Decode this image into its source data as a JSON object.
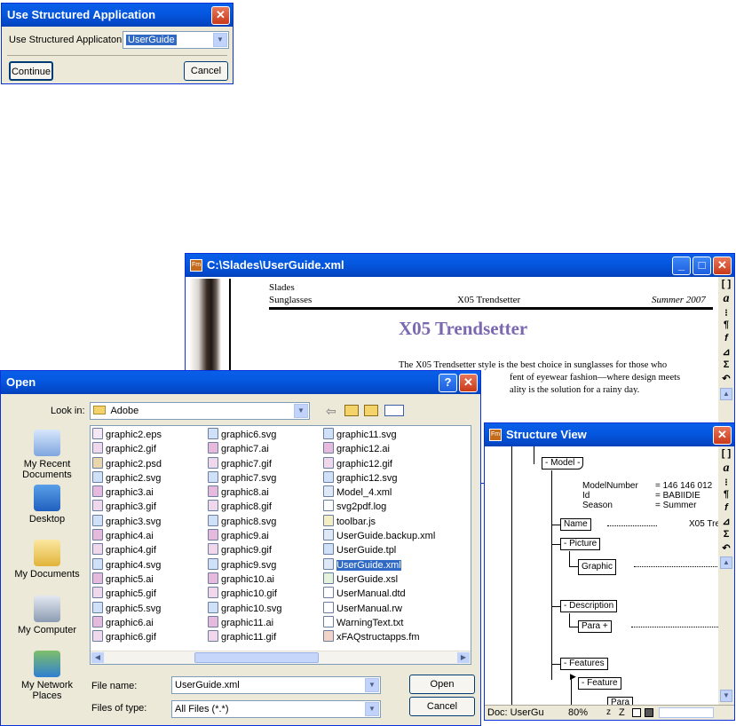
{
  "structured_dialog": {
    "title": "Use Structured Application",
    "label": "Use Structured Applicaton:",
    "value": "UserGuide",
    "continue_label": "Continue",
    "cancel_label": "Cancel"
  },
  "doc_window": {
    "title": "C:\\Slades\\UserGuide.xml",
    "header_brand": "Slades",
    "header_category": "Sunglasses",
    "header_center": "X05  Trendsetter",
    "header_season": "Summer  2007",
    "heading": "X05 Trendsetter",
    "body_lines": [
      "The X05 Trendsetter style is the best choice in sunglasses for those who",
      "fent of eyewear fashion—where design meets",
      "ality is the solution for a rainy day."
    ],
    "heading_color": "#7a68b0",
    "tools": [
      "[ ]",
      "a",
      "⁝",
      "¶",
      "f",
      "⊿",
      "Σ",
      "↶"
    ]
  },
  "open_dialog": {
    "title": "Open",
    "look_in_label": "Look in:",
    "look_in_value": "Adobe",
    "places": [
      "My Recent Documents",
      "Desktop",
      "My Documents",
      "My Computer",
      "My Network Places"
    ],
    "files_col1": [
      "graphic2.eps",
      "graphic2.gif",
      "graphic2.psd",
      "graphic2.svg",
      "graphic3.ai",
      "graphic3.gif",
      "graphic3.svg",
      "graphic4.ai",
      "graphic4.gif",
      "graphic4.svg",
      "graphic5.ai",
      "graphic5.gif",
      "graphic5.svg",
      "graphic6.ai",
      "graphic6.gif"
    ],
    "files_col2": [
      "graphic6.svg",
      "graphic7.ai",
      "graphic7.gif",
      "graphic7.svg",
      "graphic8.ai",
      "graphic8.gif",
      "graphic8.svg",
      "graphic9.ai",
      "graphic9.gif",
      "graphic9.svg",
      "graphic10.ai",
      "graphic10.gif",
      "graphic10.svg",
      "graphic11.ai",
      "graphic11.gif"
    ],
    "files_col3": [
      "graphic11.svg",
      "graphic12.ai",
      "graphic12.gif",
      "graphic12.svg",
      "Model_4.xml",
      "svg2pdf.log",
      "toolbar.js",
      "UserGuide.backup.xml",
      "UserGuide.tpl",
      "UserGuide.xml",
      "UserGuide.xsl",
      "UserManual.dtd",
      "UserManual.rw",
      "WarningText.txt",
      "xFAQstructapps.fm"
    ],
    "selected_file": "UserGuide.xml",
    "file_name_label": "File name:",
    "file_name_value": "UserGuide.xml",
    "files_of_type_label": "Files of type:",
    "files_of_type_value": "All Files (*.*)",
    "open_label": "Open",
    "cancel_label": "Cancel"
  },
  "structure_view": {
    "title": "Structure View",
    "model_label": "Model",
    "attr_names": [
      "ModelNumber",
      "Id",
      "Season"
    ],
    "attr_values": [
      "= 146 146 012",
      "= BABIIDIE",
      "= Summer"
    ],
    "name_label": "Name",
    "name_value": "X05 Tre",
    "picture_label": "Picture",
    "graphic_label": "Graphic",
    "description_label": "Description",
    "para_label": "Para",
    "features_label": "Features",
    "feature_label": "Feature",
    "para2_label": "Para",
    "status_doc": "Doc: UserGu",
    "status_zoom": "80%",
    "status_z1": "z",
    "status_z2": "Z"
  }
}
